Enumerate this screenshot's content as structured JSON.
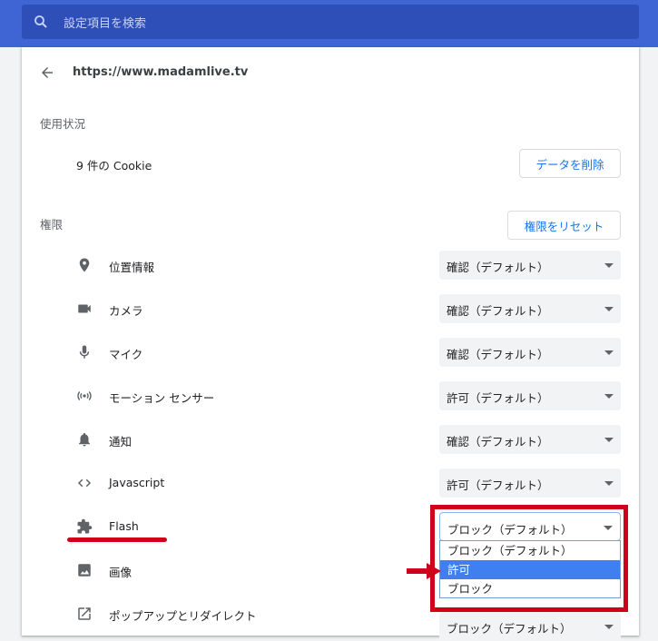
{
  "search": {
    "placeholder": "設定項目を検索"
  },
  "site": {
    "url": "https://www.madamlive.tv"
  },
  "usage": {
    "heading": "使用状況",
    "cookies": "9 件の Cookie",
    "clear_button": "データを削除"
  },
  "permissions": {
    "heading": "権限",
    "reset_button": "権限をリセット",
    "items": [
      {
        "label": "位置情報",
        "icon": "location-pin-icon",
        "value": "確認（デフォルト）"
      },
      {
        "label": "カメラ",
        "icon": "camera-icon",
        "value": "確認（デフォルト）"
      },
      {
        "label": "マイク",
        "icon": "microphone-icon",
        "value": "確認（デフォルト）"
      },
      {
        "label": "モーション センサー",
        "icon": "motion-sensor-icon",
        "value": "許可（デフォルト）"
      },
      {
        "label": "通知",
        "icon": "bell-icon",
        "value": "確認（デフォルト）"
      },
      {
        "label": "Javascript",
        "icon": "code-icon",
        "value": "許可（デフォルト）"
      },
      {
        "label": "Flash",
        "icon": "puzzle-icon",
        "value": "ブロック（デフォルト）"
      },
      {
        "label": "画像",
        "icon": "image-icon",
        "value": ""
      },
      {
        "label": "ポップアップとリダイレクト",
        "icon": "open-in-new-icon",
        "value": "ブロック（デフォルト）"
      }
    ],
    "flash_options": [
      "ブロック（デフォルト）",
      "許可",
      "ブロック"
    ],
    "flash_selected_option": "許可"
  },
  "colors": {
    "header": "#3f64d4",
    "accent": "#1a73e8",
    "annotation": "#d0021b",
    "selected_option": "#3f7ff0"
  }
}
